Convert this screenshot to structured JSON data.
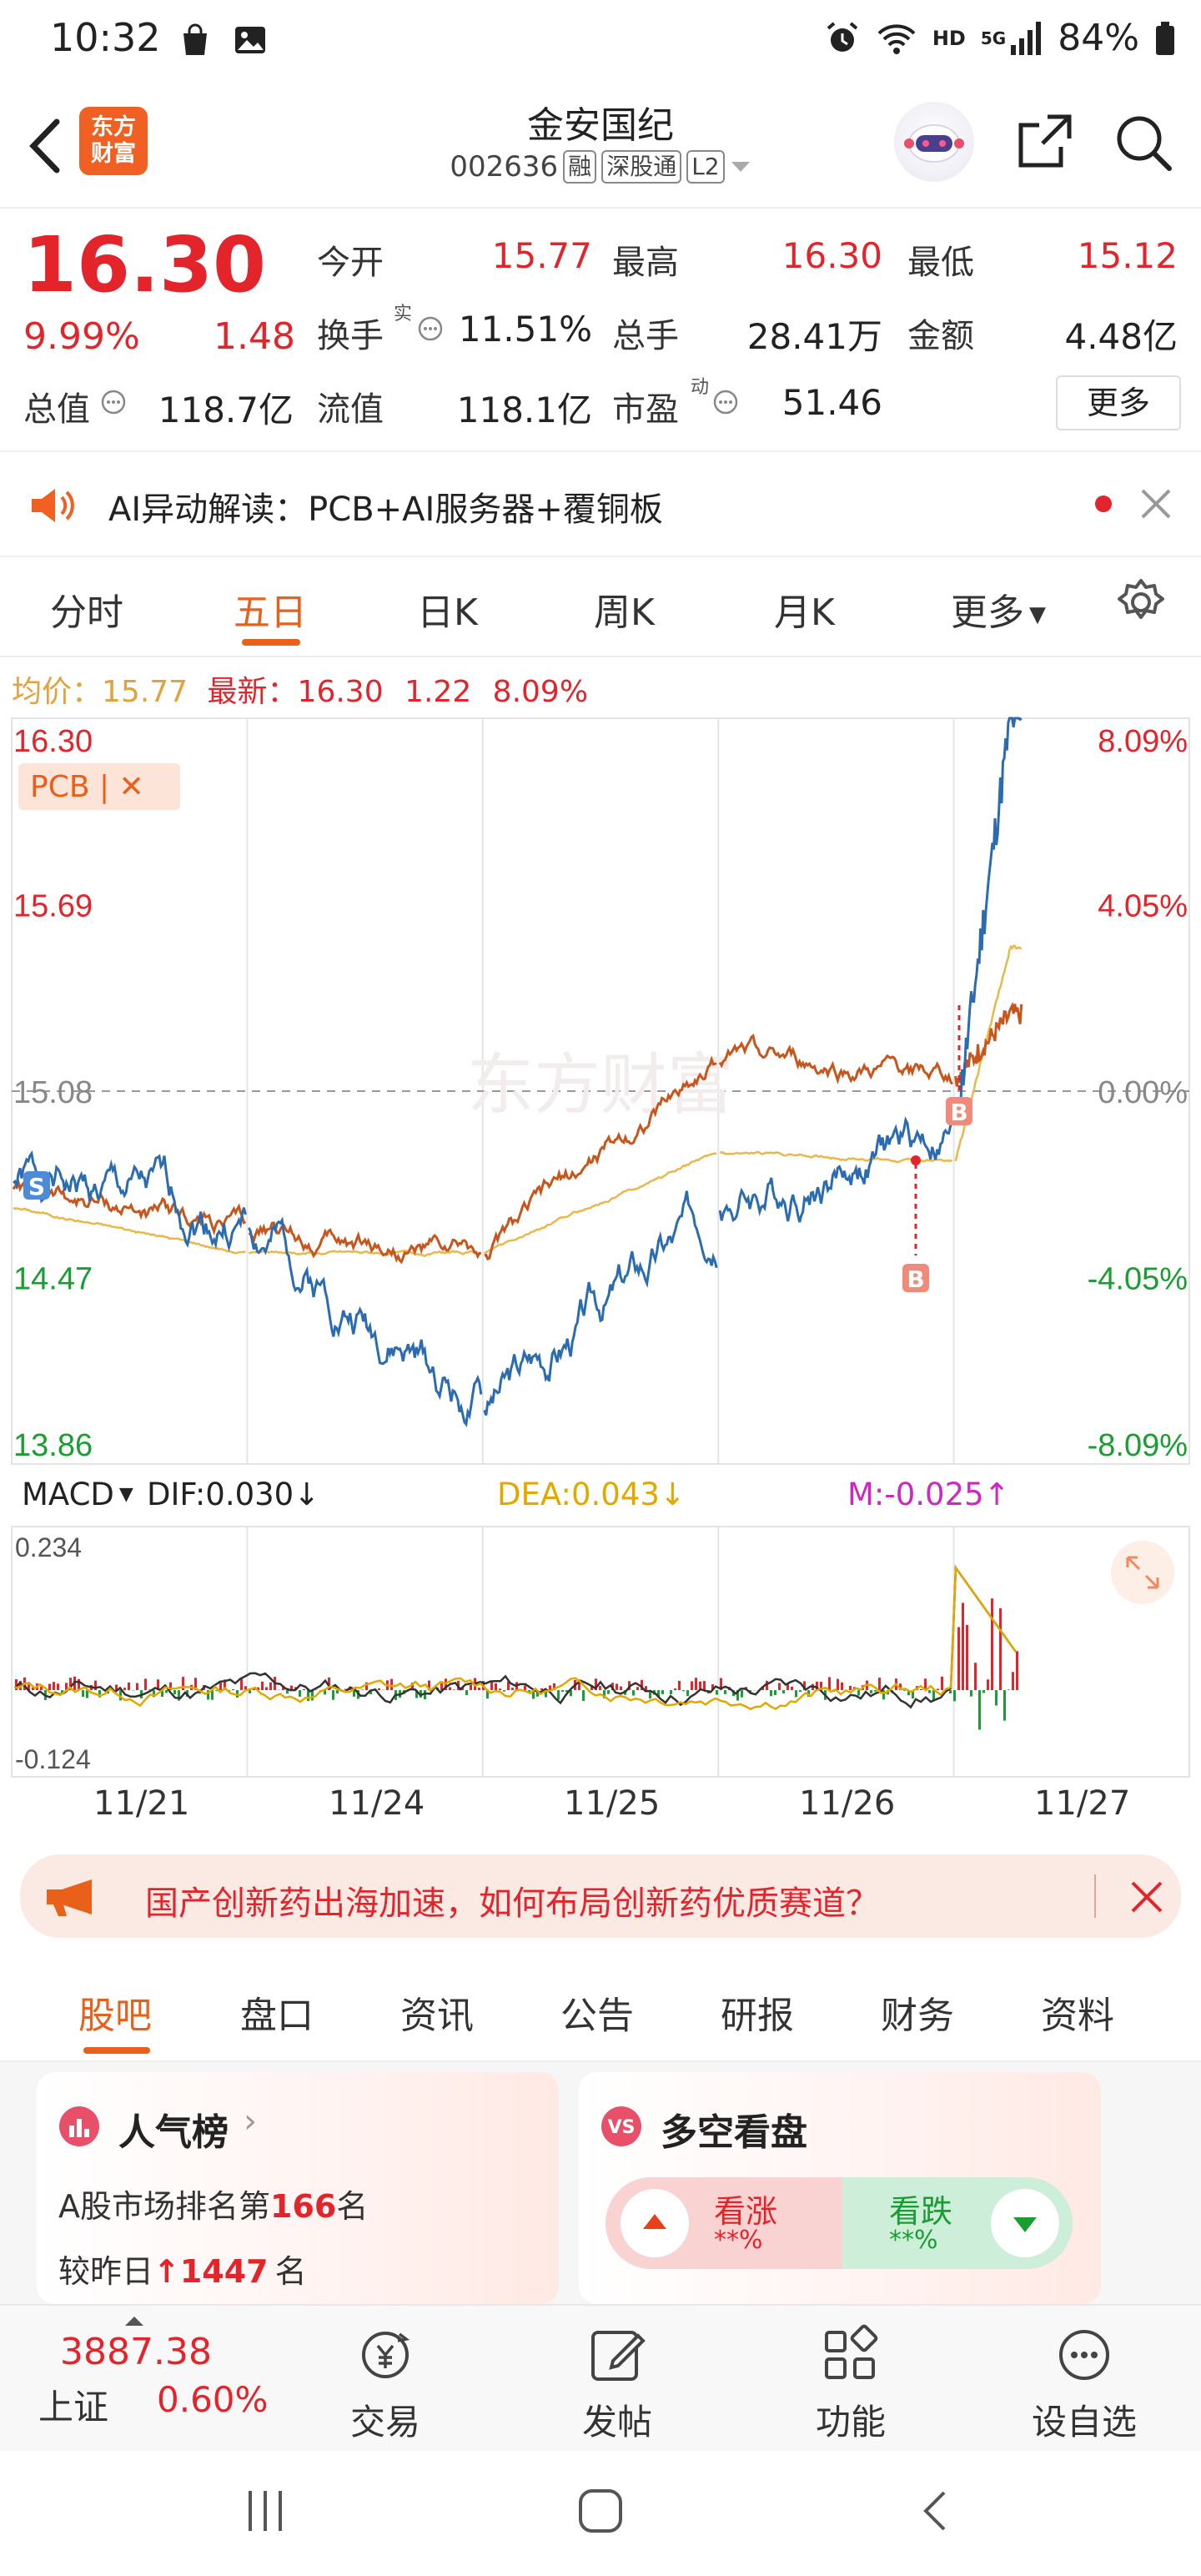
{
  "status_bar": {
    "time": "10:32",
    "network": "HD",
    "signal": "5G",
    "battery": "84%"
  },
  "header": {
    "title": "金安国纪",
    "code": "002636",
    "tags": [
      "融",
      "深股通",
      "L2"
    ],
    "logo_text_1": "东方",
    "logo_text_2": "财富"
  },
  "quote": {
    "price": "16.30",
    "change_pct": "9.99%",
    "change": "1.48",
    "rows": [
      [
        {
          "label": "今开",
          "value": "15.77",
          "red": true
        },
        {
          "label": "最高",
          "value": "16.30",
          "red": true
        },
        {
          "label": "最低",
          "value": "15.12",
          "red": true
        }
      ],
      [
        {
          "label": "换手",
          "value": "11.51%",
          "red": false
        },
        {
          "label": "总手",
          "value": "28.41万",
          "red": false
        },
        {
          "label": "金额",
          "value": "4.48亿",
          "red": false
        }
      ],
      [
        {
          "label": "总值",
          "value": "118.7亿",
          "red": false
        },
        {
          "label": "流值",
          "value": "118.1亿",
          "red": false
        },
        {
          "label": "市盈",
          "value": "51.46",
          "red": false
        }
      ]
    ],
    "turnover_sup": "实",
    "pe_sup": "动",
    "more_label": "更多"
  },
  "ai_bar": {
    "text": "AI异动解读：PCB+AI服务器+覆铜板"
  },
  "chart_tabs": [
    "分时",
    "五日",
    "日K",
    "周K",
    "月K",
    "更多"
  ],
  "chart_tabs_active": 1,
  "avg_line": {
    "avg_label": "均价：",
    "avg_value": "15.77",
    "latest_label": "最新：",
    "latest_value": "16.30",
    "change": "1.22",
    "change_pct": "8.09%"
  },
  "chart": {
    "price_labels": [
      "16.30",
      "15.69",
      "15.08",
      "14.47",
      "13.86"
    ],
    "pct_labels": [
      "8.09%",
      "4.05%",
      "0.00%",
      "-4.05%",
      "-8.09%"
    ],
    "pcb_tag": "PCB | ✕",
    "macd_label": "MACD",
    "dif": "DIF:0.030↓",
    "dea": "DEA:0.043↓",
    "m": "M:-0.025↑",
    "macd_max": "0.234",
    "macd_min": "-0.124",
    "dates": [
      "11/21",
      "11/24",
      "11/25",
      "11/26",
      "11/27"
    ],
    "marker_s": "S",
    "marker_b": "B",
    "watermark": "东方财富"
  },
  "chart_data": {
    "type": "line",
    "title": "",
    "x": [
      "11/21",
      "11/24",
      "11/25",
      "11/26",
      "11/27"
    ],
    "ylim": [
      13.86,
      16.3
    ],
    "y_ticks": [
      13.86,
      14.47,
      15.08,
      15.69,
      16.3
    ],
    "reference_price": 15.08,
    "series": [
      {
        "name": "",
        "color": "#2b6cb0",
        "values": [
          14.65,
          14.05,
          14.7,
          14.95,
          16.3
        ]
      },
      {
        "name": "均价",
        "color": "#e8b84a",
        "values": [
          14.55,
          14.55,
          14.88,
          14.85,
          15.55
        ]
      },
      {
        "name": "PCB",
        "color": "#c8561c",
        "values": [
          14.62,
          14.55,
          15.18,
          15.12,
          15.33
        ]
      }
    ],
    "macd": {
      "ylim": [
        -0.124,
        0.234
      ],
      "dif": 0.03,
      "dea": 0.043,
      "m": -0.025
    }
  },
  "promo": {
    "text": "国产创新药出海加速，如何布局创新药优质赛道？"
  },
  "bottom_tabs": [
    "股吧",
    "盘口",
    "资讯",
    "公告",
    "研报",
    "财务",
    "资料"
  ],
  "bottom_tabs_active": 0,
  "popularity": {
    "title": "人气榜",
    "line1_pre": "A股市场排名第",
    "line1_num": "166",
    "line1_post": "名",
    "line2_pre": "较昨日",
    "line2_num": "1447",
    "line2_post": "名"
  },
  "sentiment": {
    "title": "多空看盘",
    "up_label": "看涨",
    "up_value": "**%",
    "down_label": "看跌",
    "down_value": "**%"
  },
  "index": {
    "value": "3887.38",
    "name": "上证",
    "pct": "0.60%"
  },
  "nav": [
    {
      "label": "交易"
    },
    {
      "label": "发帖"
    },
    {
      "label": "功能"
    },
    {
      "label": "设自选"
    }
  ],
  "colors": {
    "accent": "#e8601a",
    "up": "#e3242b",
    "down": "#1a9e33",
    "price_line": "#2b6cb0",
    "avg_line": "#e8b84a",
    "pcb_line": "#c8561c"
  }
}
